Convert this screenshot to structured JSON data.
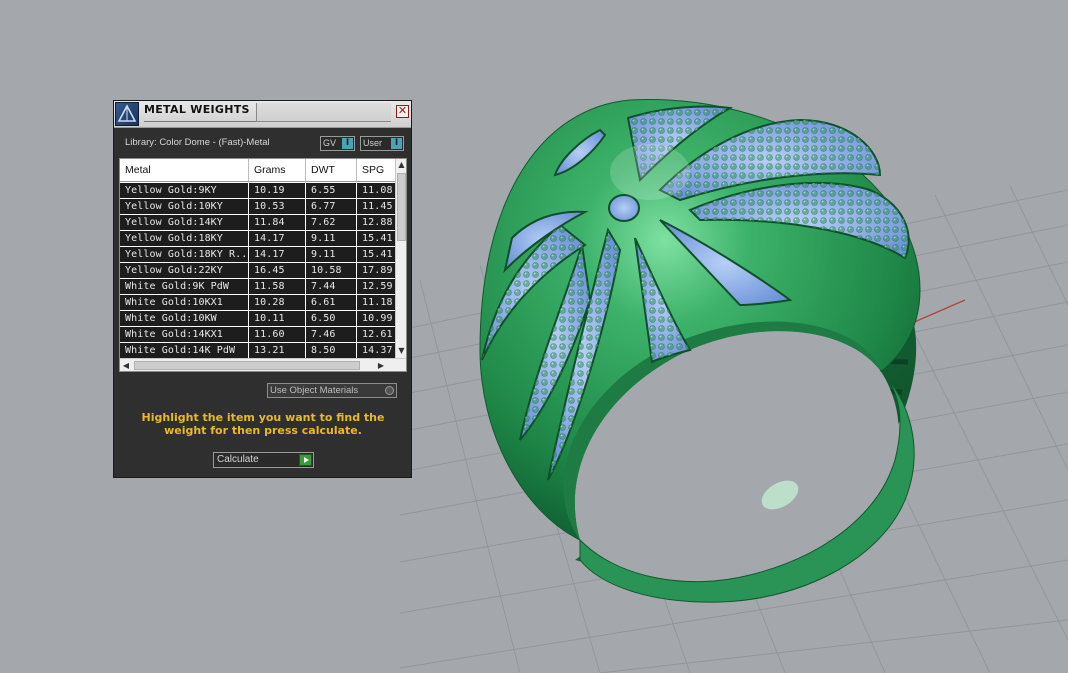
{
  "panel": {
    "title": "METAL WEIGHTS",
    "close_glyph": "✕",
    "logo_icon": "triangle-logo-icon",
    "library_label": "Library: Color Dome - (Fast)-Metal",
    "toggles": [
      {
        "label": "GV",
        "knob": "I"
      },
      {
        "label": "User",
        "knob": "I"
      }
    ],
    "table": {
      "columns": [
        "Metal",
        "Grams",
        "DWT",
        "SPG"
      ],
      "rows": [
        [
          "Yellow Gold:9KY",
          "10.19",
          "6.55",
          "11.08"
        ],
        [
          "Yellow Gold:10KY",
          "10.53",
          "6.77",
          "11.45"
        ],
        [
          "Yellow Gold:14KY",
          "11.84",
          "7.62",
          "12.88"
        ],
        [
          "Yellow Gold:18KY",
          "14.17",
          "9.11",
          "15.41"
        ],
        [
          "Yellow Gold:18KY R...",
          "14.17",
          "9.11",
          "15.41"
        ],
        [
          "Yellow Gold:22KY",
          "16.45",
          "10.58",
          "17.89"
        ],
        [
          "White Gold:9K PdW",
          "11.58",
          "7.44",
          "12.59"
        ],
        [
          "White Gold:10KX1",
          "10.28",
          "6.61",
          "11.18"
        ],
        [
          "White Gold:10KW",
          "10.11",
          "6.50",
          "10.99"
        ],
        [
          "White Gold:14KX1",
          "11.60",
          "7.46",
          "12.61"
        ],
        [
          "White Gold:14K PdW",
          "13.21",
          "8.50",
          "14.37"
        ]
      ]
    },
    "use_object_materials_label": "Use Object Materials",
    "hint": "Highlight the item you want to find the weight for then press calculate.",
    "calculate_label": "Calculate"
  },
  "viewport": {
    "ring_color": "#2e9a55",
    "stone_color": "#7fa6e6",
    "background_color": "#a4a8ad",
    "grid_color": "#8f9499"
  }
}
